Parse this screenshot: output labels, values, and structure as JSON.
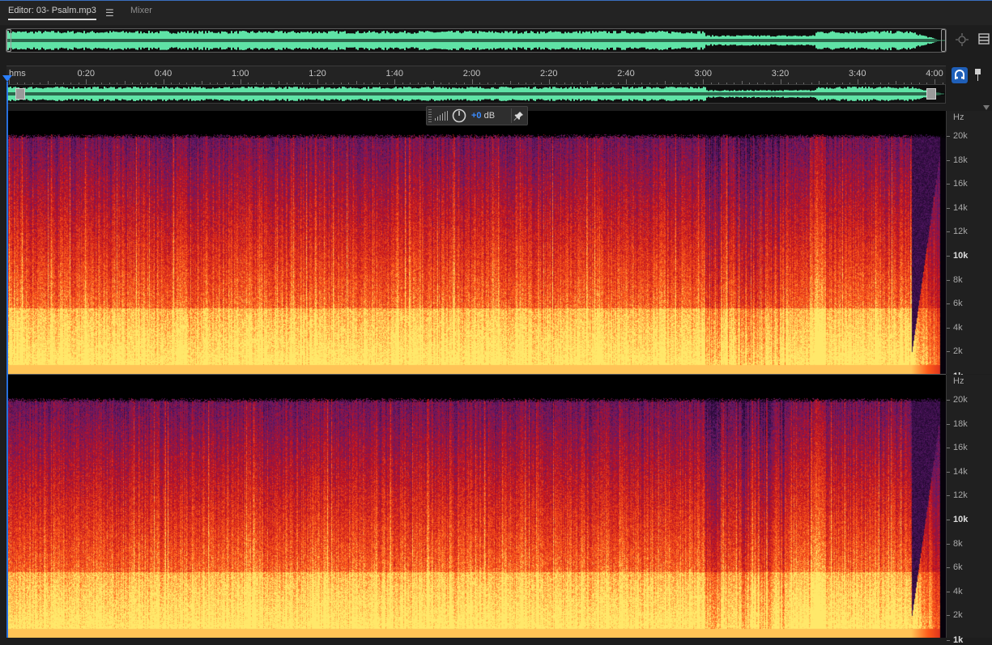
{
  "tabs": {
    "editor_label": "Editor: 03- Psalm.mp3",
    "menu_glyph": "☰",
    "mixer_label": "Mixer"
  },
  "overview": {
    "waveform_color": "#5fe3a6",
    "zoom_icon": "zoom-to-fit-icon",
    "view_menu_icon": "panel-menu-icon"
  },
  "timeline": {
    "unit_label": "hms",
    "ticks": [
      "0:20",
      "0:40",
      "1:00",
      "1:20",
      "1:40",
      "2:00",
      "2:20",
      "2:40",
      "3:00",
      "3:20",
      "3:40",
      "4:00"
    ],
    "duration_seconds": 245,
    "playhead_color": "#2a7fff",
    "snap_icon": "snap-magnet-icon",
    "marker_icon": "marker-pin-icon"
  },
  "hud": {
    "value": "+0",
    "unit": " dB",
    "knob_icon": "volume-knob-icon",
    "meter_icon": "level-meter-icon",
    "pin_icon": "pin-icon"
  },
  "spectral_display": {
    "channels": 2,
    "unit_label": "Hz",
    "labels": [
      "20k",
      "18k",
      "16k",
      "14k",
      "12k",
      "10k",
      "8k",
      "6k",
      "4k",
      "2k",
      "1k"
    ],
    "strong_labels": [
      "10k",
      "1k"
    ],
    "colors": {
      "low": "#1a0628",
      "mid_low": "#5e1a6e",
      "mid": "#c0111e",
      "high": "#ff5a1a",
      "peak": "#ffe86a"
    }
  }
}
